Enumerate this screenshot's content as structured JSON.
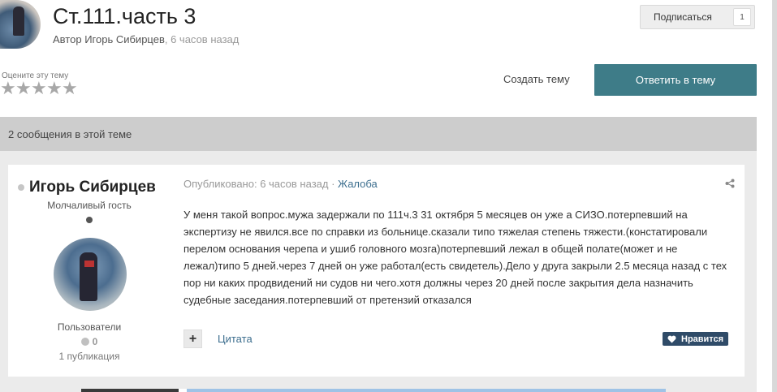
{
  "topic": {
    "title": "Ст.111.часть 3",
    "author_prefix": "Автор",
    "author_name": "Игорь Сибирцев",
    "posted_time": ", 6 часов назад"
  },
  "subscribe": {
    "label": "Подписаться",
    "count": "1"
  },
  "rating": {
    "label": "Оцените эту тему",
    "stars": [
      "★",
      "★",
      "★",
      "★",
      "★"
    ]
  },
  "actions": {
    "create_topic": "Создать тему",
    "reply": "Ответить в тему"
  },
  "messages_count_text": "2 сообщения в этой теме",
  "post": {
    "author": "Игорь Сибирцев",
    "group": "Молчаливый гость",
    "users_label": "Пользователи",
    "reputation": "0",
    "publications": "1 публикация",
    "published_label": "Опубликовано: 6 часов назад",
    "separator": " · ",
    "report_label": "Жалоба",
    "body": "У меня такой вопрос.мужа задержали по 111ч.3 31 октября 5 месяцев он уже а СИЗО.потерпевший на экспертизу не явился.все по справки из больнице.сказали типо тяжелая степень тяжести.(констатировали перелом основания черепа и ушиб головного мозга)потерпевший лежал в общей полате(может и не лежал)типо 5 дней.через 7 дней он уже работал(есть свидетель).Дело у друга закрыли 2.5 месяца назад с тех пор ни каких продвидений ни судов ни чего.хотя должны через 20 дней после закрытия дела назначить судебные заседания.потерпевший от претензий отказался",
    "plus_label": "+",
    "quote_label": "Цитата",
    "like_label": "Нравится"
  },
  "icons": {
    "share": "share-icon",
    "heart": "heart-icon",
    "online": "online-status-icon"
  },
  "colors": {
    "reply_button": "#3e7c88",
    "like_button": "#2f4b68",
    "link": "#3c6e8e",
    "count_bar": "#cdcdcd"
  }
}
